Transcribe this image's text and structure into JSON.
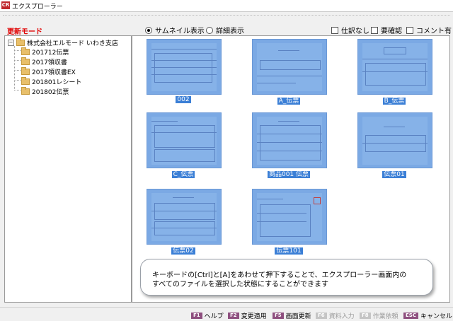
{
  "window": {
    "app_icon": "CR",
    "title": "エクスプローラー"
  },
  "toolbar": {
    "mode_label": "更新モード",
    "view_thumbnail": "サムネイル表示",
    "view_detail": "詳細表示",
    "selected_view": "thumbnail",
    "check_no_journal": "仕訳なし",
    "check_needs_review": "要確認",
    "check_has_comment": "コメント有"
  },
  "tree": {
    "root": {
      "label": "株式会社エルモード いわき支店",
      "expander": "−"
    },
    "children": [
      {
        "label": "201712伝票"
      },
      {
        "label": "2017領収書"
      },
      {
        "label": "2017領収書EX"
      },
      {
        "label": "201801レシート"
      },
      {
        "label": "201802伝票"
      }
    ]
  },
  "thumbnails": [
    {
      "label": "002"
    },
    {
      "label": "A_伝票"
    },
    {
      "label": "B_伝票"
    },
    {
      "label": "C_伝票"
    },
    {
      "label": "商品001 伝票"
    },
    {
      "label": "伝票01"
    },
    {
      "label": "伝票02"
    },
    {
      "label": "伝票101"
    }
  ],
  "tip": {
    "line1": "キーボードの[Ctrl]と[A]をあわせて押下することで、エクスプローラー画面内の",
    "line2": "すべてのファイルを選択した状態にすることができます"
  },
  "footer": [
    {
      "key": "F1",
      "label": "ヘルプ",
      "enabled": true
    },
    {
      "key": "F2",
      "label": "変更適用",
      "enabled": true
    },
    {
      "key": "F5",
      "label": "画面更新",
      "enabled": true
    },
    {
      "key": "F6",
      "label": "資料入力",
      "enabled": false
    },
    {
      "key": "F8",
      "label": "作業依頼",
      "enabled": false
    },
    {
      "key": "ESC",
      "label": "キャンセル",
      "enabled": true
    }
  ],
  "colors": {
    "mode_label": "#e00000",
    "thumb_fill": "#7ba9e4",
    "selection": "#3b7fd6",
    "fkey": "#8e4f7f"
  }
}
